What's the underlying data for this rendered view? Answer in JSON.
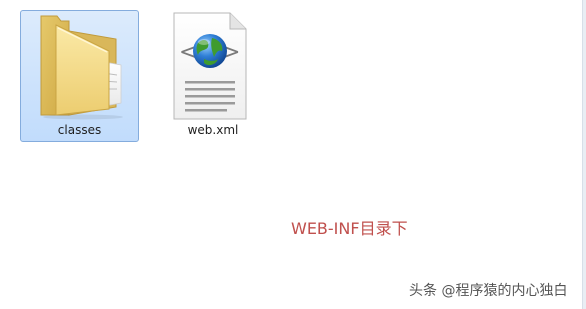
{
  "files": [
    {
      "name": "classes",
      "type": "folder",
      "selected": true,
      "icon": "folder-icon"
    },
    {
      "name": "web.xml",
      "type": "xml-file",
      "selected": false,
      "icon": "xml-file-icon"
    }
  ],
  "annotation": "WEB-INF目录下",
  "watermark": "头条 @程序猿的内心独白",
  "colors": {
    "selection_fill": "#cce4fc",
    "selection_border": "#84acdd",
    "annotation_text": "#c0504d"
  }
}
